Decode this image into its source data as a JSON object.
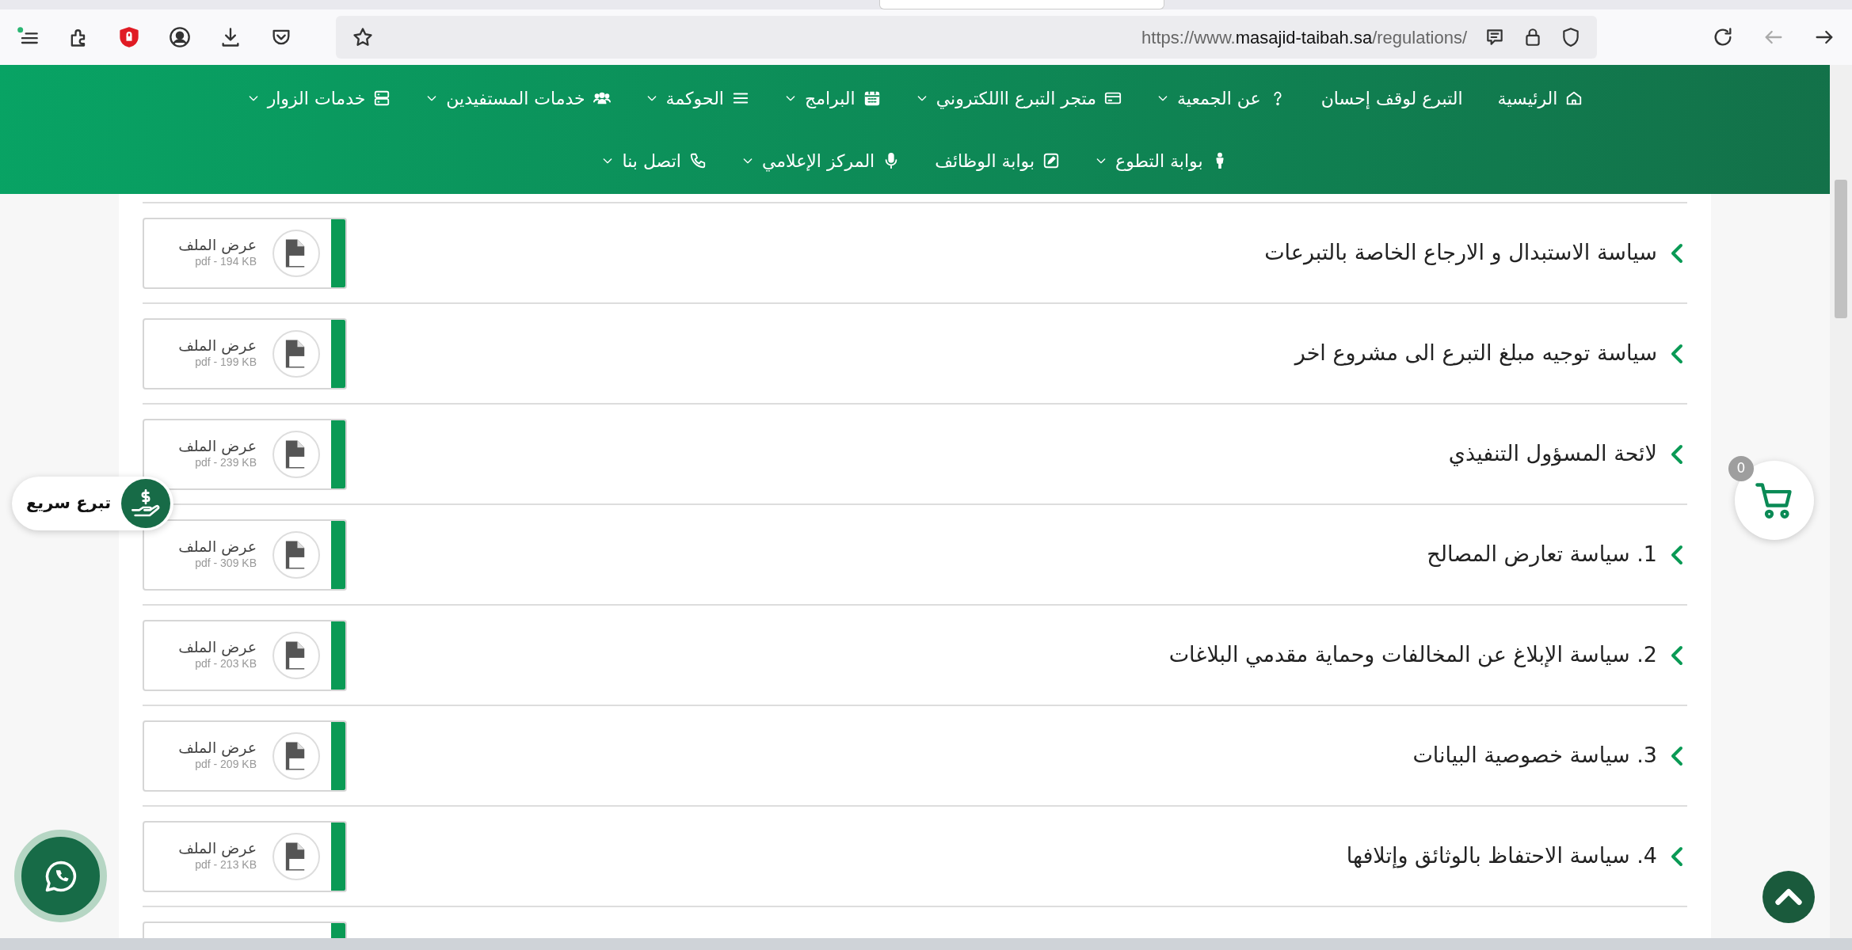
{
  "browser": {
    "url": {
      "prefix": "https://www.",
      "domain": "masajid-taibah.sa",
      "path": "/regulations/"
    }
  },
  "nav": {
    "lines": [
      {
        "items": [
          {
            "label": "الرئيسية",
            "dropdown": false
          },
          {
            "label": "التبرع لوقف إحسان",
            "dropdown": false
          },
          {
            "label": "عن الجمعية",
            "dropdown": true
          },
          {
            "label": "متجر التبرع االلكتروني",
            "dropdown": true
          },
          {
            "label": "البرامج",
            "dropdown": true
          },
          {
            "label": "الحوكمة",
            "dropdown": true
          },
          {
            "label": "خدمات المستفيدين",
            "dropdown": true
          },
          {
            "label": "خدمات الزوار",
            "dropdown": true
          }
        ]
      },
      {
        "items": [
          {
            "label": "بوابة التطوع",
            "dropdown": true
          },
          {
            "label": "بوابة الوظائف",
            "dropdown": false
          },
          {
            "label": "المركز الإعلامي",
            "dropdown": true
          },
          {
            "label": "اتصل بنا",
            "dropdown": true
          }
        ]
      }
    ]
  },
  "regulations": [
    {
      "title": "سياسة الاستبدال و الارجاع الخاصة بالتبرعات",
      "file_label": "عرض الملف",
      "file_info": "pdf - 194 KB"
    },
    {
      "title": "سياسة توجيه مبلغ التبرع الى مشروع اخر",
      "file_label": "عرض الملف",
      "file_info": "pdf - 199 KB"
    },
    {
      "title": "لائحة المسؤول التنفيذي",
      "file_label": "عرض الملف",
      "file_info": "pdf - 239 KB"
    },
    {
      "title": "1. سياسة تعارض المصالح",
      "file_label": "عرض الملف",
      "file_info": "pdf - 309 KB"
    },
    {
      "title": "2. سياسة الإبلاغ عن المخالفات وحماية مقدمي البلاغات",
      "file_label": "عرض الملف",
      "file_info": "pdf - 203 KB"
    },
    {
      "title": "3. سياسة خصوصية البيانات",
      "file_label": "عرض الملف",
      "file_info": "pdf - 209 KB"
    },
    {
      "title": "4. سياسة الاحتفاظ بالوثائق وإتلافها",
      "file_label": "عرض الملف",
      "file_info": "pdf - 213 KB"
    }
  ],
  "quick_donate": {
    "label": "تبرع سريع"
  },
  "cart": {
    "count": "0"
  }
}
